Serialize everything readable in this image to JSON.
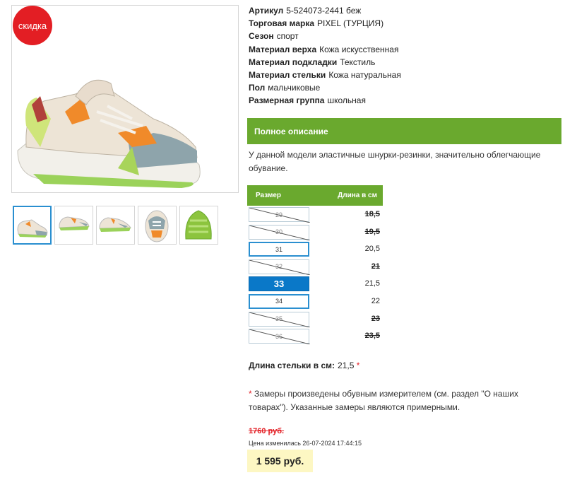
{
  "sale_badge": "скидка",
  "attributes": [
    {
      "label": "Артикул",
      "value": "5-524073-2441 беж"
    },
    {
      "label": "Торговая марка",
      "value": "PIXEL (ТУРЦИЯ)"
    },
    {
      "label": "Сезон",
      "value": "спорт"
    },
    {
      "label": "Материал верха",
      "value": "Кожа искусственная"
    },
    {
      "label": "Материал подкладки",
      "value": "Текстиль"
    },
    {
      "label": "Материал стельки",
      "value": "Кожа натуральная"
    },
    {
      "label": "Пол",
      "value": "мальчиковые"
    },
    {
      "label": "Размерная группа",
      "value": "школьная"
    }
  ],
  "description": {
    "header": "Полное описание",
    "text": "У данной модели эластичные шнурки-резинки, значительно облегчающие обувание."
  },
  "size_table": {
    "col_size": "Размер",
    "col_length": "Длина в см",
    "rows": [
      {
        "size": "29",
        "length": "18,5",
        "available": false,
        "selected": false
      },
      {
        "size": "30",
        "length": "19,5",
        "available": false,
        "selected": false
      },
      {
        "size": "31",
        "length": "20,5",
        "available": true,
        "selected": false
      },
      {
        "size": "32",
        "length": "21",
        "available": false,
        "selected": false
      },
      {
        "size": "33",
        "length": "21,5",
        "available": true,
        "selected": true
      },
      {
        "size": "34",
        "length": "22",
        "available": true,
        "selected": false
      },
      {
        "size": "35",
        "length": "23",
        "available": false,
        "selected": false
      },
      {
        "size": "36",
        "length": "23,5",
        "available": false,
        "selected": false
      }
    ]
  },
  "insole": {
    "label": "Длина стельки в см:",
    "value": "21,5",
    "mark": "*"
  },
  "note": {
    "mark": "*",
    "text_before": "Замеры произведены обувным измерителем (см. ",
    "link": "раздел \"О наших товарах\"",
    "text_after": "). Указанные замеры являются примерными."
  },
  "price": {
    "old": "1760 руб.",
    "changed": "Цена изменилась 26-07-2024 17:44:15",
    "current": "1 595 руб."
  },
  "colors": {
    "accent_green": "#6aa92e",
    "sale_red": "#e31e24",
    "select_blue": "#0a78c8",
    "price_bg": "#fdf7c3"
  },
  "thumbnails": [
    "side-view",
    "pair-view",
    "pair-angle",
    "front-view",
    "sole-view"
  ]
}
